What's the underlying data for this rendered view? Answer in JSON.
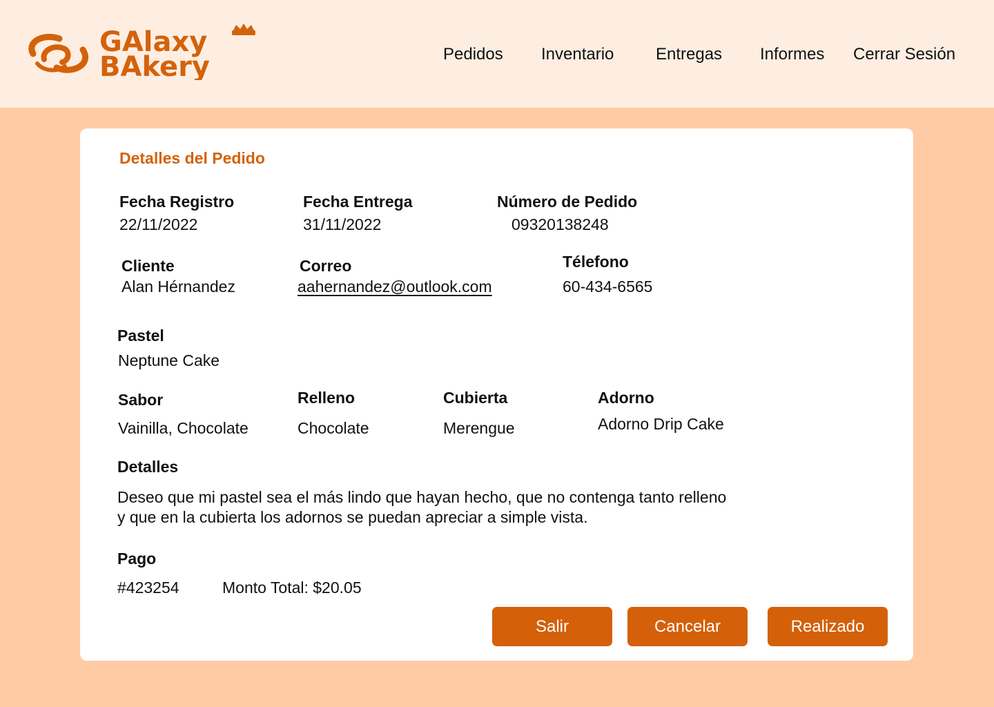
{
  "brand": {
    "logo_line1": "GAlaxy",
    "logo_line2": "BAkery",
    "color": "#D4620A"
  },
  "nav": {
    "pedidos": "Pedidos",
    "inventario": "Inventario",
    "entregas": "Entregas",
    "informes": "Informes",
    "cerrar_sesion": "Cerrar Sesión"
  },
  "order": {
    "section_title": "Detalles del Pedido",
    "fecha_registro": {
      "label": "Fecha Registro",
      "value": "22/11/2022"
    },
    "fecha_entrega": {
      "label": "Fecha Entrega",
      "value": "31/11/2022"
    },
    "numero_pedido": {
      "label": "Número de Pedido",
      "value": "09320138248"
    },
    "cliente": {
      "label": "Cliente",
      "value": "Alan Hérnandez"
    },
    "correo": {
      "label": "Correo",
      "value": "aahernandez@outlook.com"
    },
    "telefono": {
      "label": "Télefono",
      "value": "60-434-6565"
    },
    "pastel": {
      "label": "Pastel",
      "value": "Neptune Cake"
    },
    "sabor": {
      "label": "Sabor",
      "value": "Vainilla, Chocolate"
    },
    "relleno": {
      "label": "Relleno",
      "value": "Chocolate"
    },
    "cubierta": {
      "label": "Cubierta",
      "value": "Merengue"
    },
    "adorno": {
      "label": "Adorno",
      "value": "Adorno Drip Cake"
    },
    "detalles": {
      "label": "Detalles",
      "line1": "Deseo que mi pastel sea el más lindo que hayan hecho, que no contenga tanto relleno",
      "line2": "y que en la cubierta los adornos se puedan apreciar a simple vista."
    },
    "pago": {
      "label": "Pago",
      "id": "#423254",
      "monto": "Monto Total: $20.05"
    }
  },
  "actions": {
    "salir": "Salir",
    "cancelar": "Cancelar",
    "realizado": "Realizado",
    "button_color": "#D4600A"
  },
  "colors": {
    "header_bg": "#FEEEE2",
    "page_bg": "#FFCBA4",
    "card_bg": "#FFFFFF",
    "accent": "#D4620A"
  }
}
